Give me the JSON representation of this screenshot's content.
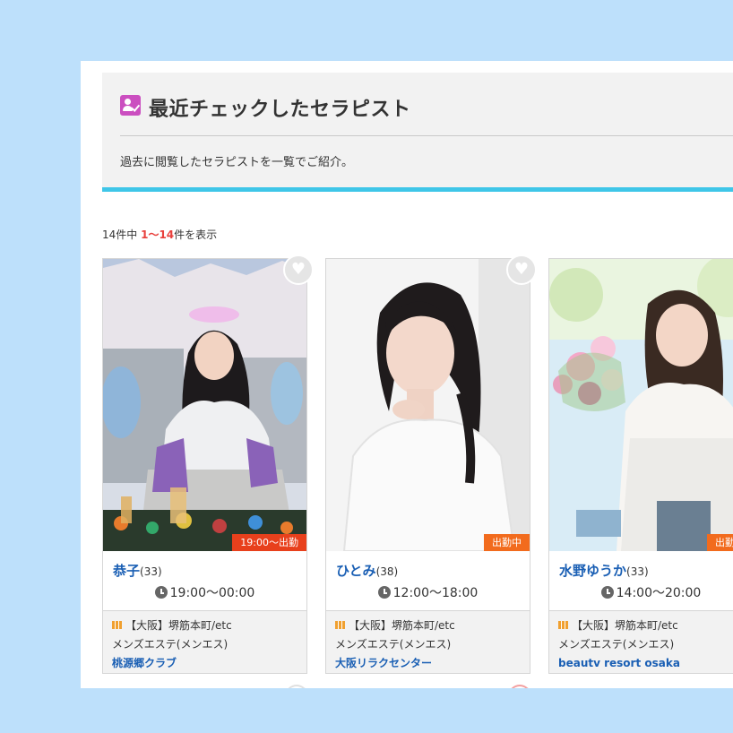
{
  "section": {
    "title": "最近チェックしたセラピスト",
    "description": "過去に閲覧したセラピストを一覧でご紹介。",
    "icon": "user-check-icon",
    "accent_color": "#3fc6e8"
  },
  "results": {
    "total_prefix": "14件中 ",
    "range": "1〜14",
    "suffix": "件を表示"
  },
  "cards": [
    {
      "name": "恭子",
      "age": "(33)",
      "status": "19:00〜出勤",
      "hours": "19:00〜00:00",
      "area": "【大阪】堺筋本町/etc",
      "genre": "メンズエステ(メンエス)",
      "shop": "桃源郷クラブ"
    },
    {
      "name": "ひとみ",
      "age": "(38)",
      "status": "出勤中",
      "hours": "12:00〜18:00",
      "area": "【大阪】堺筋本町/etc",
      "genre": "メンズエステ(メンエス)",
      "shop": "大阪リラクセンター"
    },
    {
      "name": "水野ゆうか",
      "age": "(33)",
      "status": "出勤中",
      "hours": "14:00〜20:00",
      "area": "【大阪】堺筋本町/etc",
      "genre": "メンズエステ(メンエス)",
      "shop": "beautv resort osaka"
    }
  ]
}
